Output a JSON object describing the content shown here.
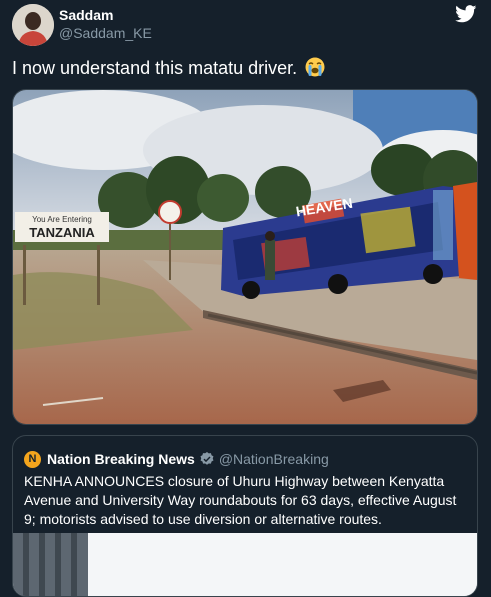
{
  "tweet": {
    "display_name": "Saddam",
    "handle": "@Saddam_KE",
    "text": "I now understand this matatu driver.",
    "emoji": "loudly-crying-face-emoji"
  },
  "photo": {
    "sign_top": "You Are Entering",
    "sign_main": "TANZANIA",
    "bus_text": "HEAVEN"
  },
  "quoted_tweet": {
    "logo_letter": "N",
    "name": "Nation Breaking News",
    "handle": "@NationBreaking",
    "text": "KENHA ANNOUNCES closure of Uhuru Highway between Kenyatta Avenue and University Way roundabouts for 63 days, effective August 9; motorists advised to use diversion or alternative routes."
  },
  "colors": {
    "background": "#15202b",
    "border": "#38444d",
    "secondary_text": "#8899a6",
    "verified": "#8899a6"
  },
  "icons": [
    "twitter-bird-icon",
    "verified-badge-icon"
  ]
}
